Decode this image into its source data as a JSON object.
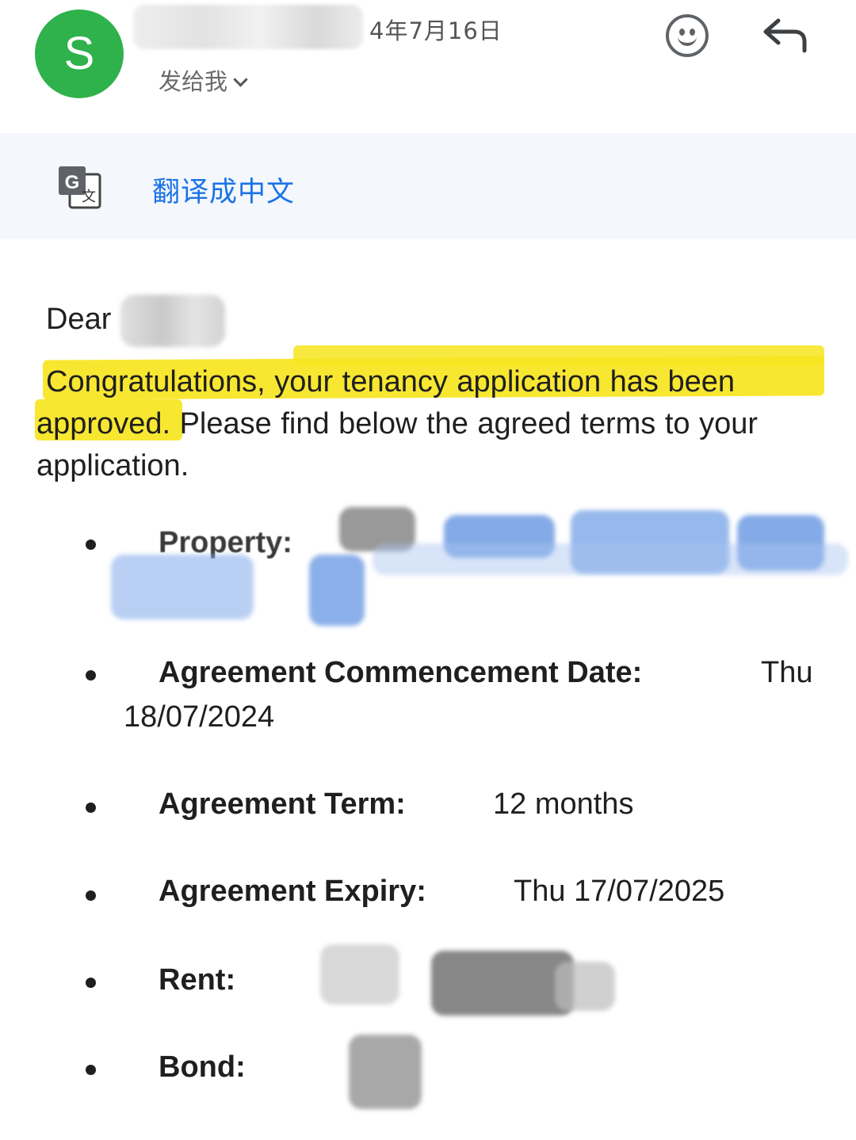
{
  "header": {
    "avatar_letter": "S",
    "date": "4年7月16日",
    "recipient_label": "发给我"
  },
  "translate": {
    "label": "翻译成中文"
  },
  "email": {
    "greeting": "Dear",
    "intro_highlighted_1": "Congratulations, your tenancy application has been",
    "intro_highlighted_2": "approved",
    "intro_rest": ". Please find below the agreed terms to your application."
  },
  "terms": [
    {
      "label": "Property:",
      "value": ""
    },
    {
      "label": "Agreement Commencement Date:",
      "value_line1": "Thu",
      "value_line2": "18/07/2024"
    },
    {
      "label": "Agreement Term:",
      "value": "12 months"
    },
    {
      "label": "Agreement Expiry:",
      "value": "Thu 17/07/2025"
    },
    {
      "label": "Rent:",
      "value": ""
    },
    {
      "label": "Bond:",
      "value": ""
    }
  ],
  "colors": {
    "avatar": "#2fb24c",
    "highlight": "#f7e51f",
    "translate_link": "#1a73e8",
    "translate_bar_bg": "#f4f7fb",
    "redaction_blue": "#5b8fe0",
    "redaction_gray": "#8a8a8a"
  },
  "icons": [
    "smiley-icon",
    "reply-icon",
    "google-translate-icon",
    "chevron-down-icon"
  ]
}
